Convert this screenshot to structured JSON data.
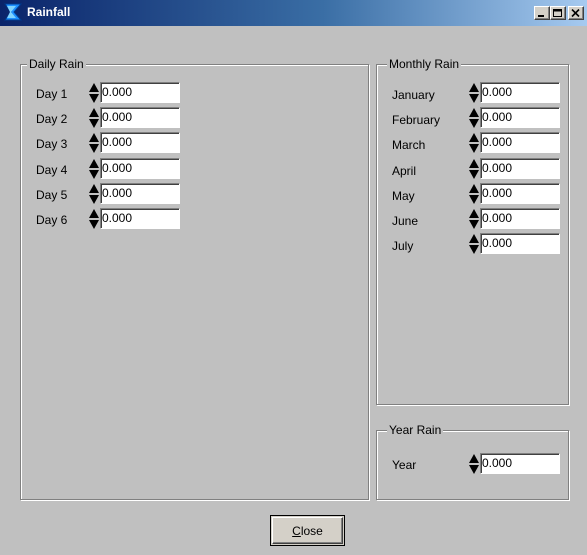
{
  "window": {
    "title": "Rainfall",
    "controls": {
      "minimize_icon": "minimize-icon",
      "maximize_icon": "maximize-icon",
      "close_icon": "close-x-icon"
    }
  },
  "daily_rain": {
    "legend": "Daily Rain",
    "fields": [
      {
        "label": "Day 1",
        "value": "0.000"
      },
      {
        "label": "Day 2",
        "value": "0.000"
      },
      {
        "label": "Day 3",
        "value": "0.000"
      },
      {
        "label": "Day 4",
        "value": "0.000"
      },
      {
        "label": "Day 5",
        "value": "0.000"
      },
      {
        "label": "Day 6",
        "value": "0.000"
      }
    ]
  },
  "monthly_rain": {
    "legend": "Monthly Rain",
    "fields": [
      {
        "label": "January",
        "value": "0.000"
      },
      {
        "label": "February",
        "value": "0.000"
      },
      {
        "label": "March",
        "value": "0.000"
      },
      {
        "label": "April",
        "value": "0.000"
      },
      {
        "label": "May",
        "value": "0.000"
      },
      {
        "label": "June",
        "value": "0.000"
      },
      {
        "label": "July",
        "value": "0.000"
      }
    ]
  },
  "year_rain": {
    "legend": "Year Rain",
    "field": {
      "label": "Year",
      "value": "0.000"
    }
  },
  "close_button": {
    "mnemonic": "C",
    "rest": "lose"
  },
  "colors": {
    "face": "#c0c0c0",
    "title_start": "#0a246a",
    "title_end": "#a6caf0",
    "title_text": "#ffffff"
  }
}
